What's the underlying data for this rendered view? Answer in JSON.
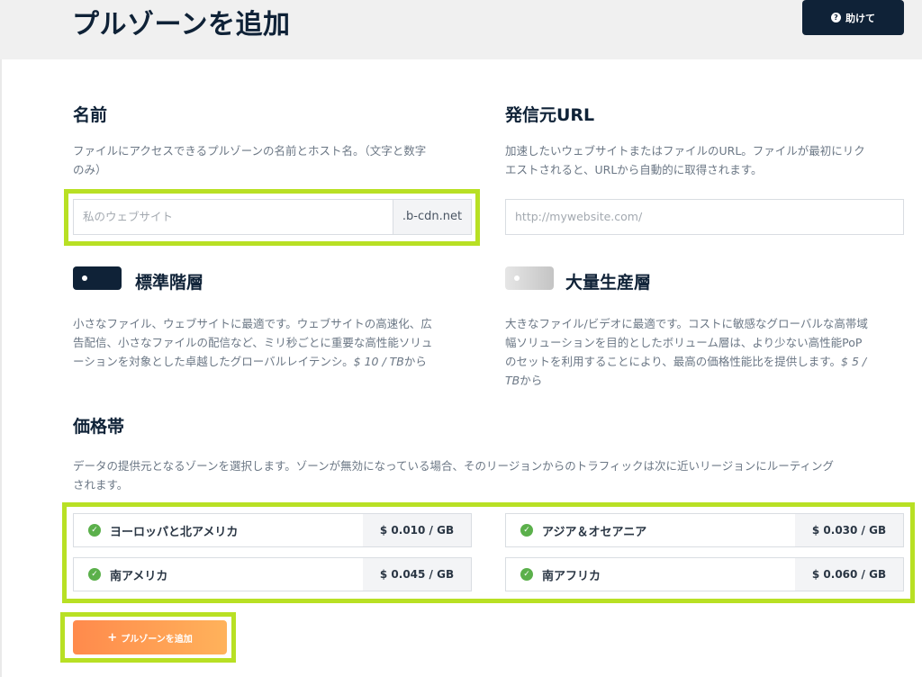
{
  "header": {
    "title": "プルゾーンを追加",
    "help_label": "助けて",
    "help_icon": "question-icon"
  },
  "name_section": {
    "heading": "名前",
    "description_line1": "ファイルにアクセスできるプルゾーンの名前とホスト名。（文字と数字",
    "description_line2": "のみ）",
    "placeholder": "私のウェブサイト",
    "suffix": ".b-cdn.net"
  },
  "origin_section": {
    "heading": "発信元URL",
    "description_line1": "加速したいウェブサイトまたはファイルのURL。ファイルが最初にリク",
    "description_line2": "エストされると、URLから自動的に取得されます。",
    "placeholder": "http://mywebsite.com/"
  },
  "tiers": {
    "standard": {
      "title": "標準階層",
      "enabled": true,
      "line1": "小さなファイル、ウェブサイトに最適です。ウェブサイトの高速化、広",
      "line2": "告配信、小さなファイルの配信など、ミリ秒ごとに重要な高性能ソリュ",
      "line3": "ーションを対象とした卓越したグローバルレイテンシ。",
      "price": "$ 10 / TB",
      "from": "から"
    },
    "volume": {
      "title": "大量生産層",
      "enabled": false,
      "line1": "大きなファイル/ビデオに最適です。コストに敏感なグローバルな高帯域",
      "line2": "幅ソリューションを目的としたボリューム層は、より少ない高性能PoP",
      "line3": "のセットを利用することにより、最高の価格性能比を提供します。",
      "price_part1": "$ 5 /",
      "price_part2": "TB",
      "from": "から"
    }
  },
  "pricing": {
    "heading": "価格帯",
    "description_line1": "データの提供元となるゾーンを選択します。ゾーンが無効になっている場合、そのリージョンからのトラフィックは次に近いリージョンにルーティング",
    "description_line2": "されます。",
    "regions": [
      {
        "name": "ヨーロッパと北アメリカ",
        "price": "$ 0.010 / GB",
        "enabled": true
      },
      {
        "name": "アジア＆オセアニア",
        "price": "$ 0.030 / GB",
        "enabled": true
      },
      {
        "name": "南アメリカ",
        "price": "$ 0.045 / GB",
        "enabled": true
      },
      {
        "name": "南アフリカ",
        "price": "$ 0.060 / GB",
        "enabled": true
      }
    ]
  },
  "actions": {
    "add_label": "プルゾーンを追加",
    "add_icon": "plus-icon"
  },
  "colors": {
    "primary": "#0f2237",
    "accent_orange": "#ff8a4c",
    "highlight": "#b8e024",
    "check": "#5bb04b"
  }
}
